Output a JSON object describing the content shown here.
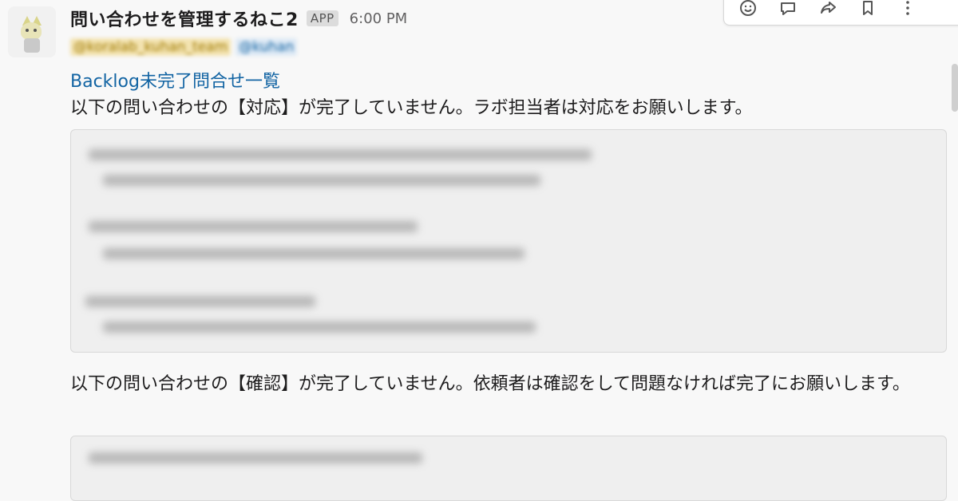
{
  "message": {
    "sender": "問い合わせを管理するねこ2",
    "badge": "APP",
    "time": "6:00 PM",
    "mentions": [
      {
        "text": "@koralab_kuhan_team",
        "kind": "group"
      },
      {
        "text": "@kuhan",
        "kind": "user"
      }
    ],
    "link_text": "Backlog未完了問合せ一覧",
    "paragraph1": "以下の問い合わせの【対応】が完了していません。ラボ担当者は対応をお願いします。",
    "paragraph2": "以下の問い合わせの【確認】が完了していません。依頼者は確認をして問題なければ完了にお願いします。"
  },
  "actions": {
    "icons": [
      "emoji-reaction-icon",
      "reply-thread-icon",
      "share-icon",
      "bookmark-icon",
      "more-options-icon"
    ]
  },
  "colors": {
    "link": "#1264a3",
    "background": "#f8f8f8",
    "codeblock_bg": "#efefef"
  }
}
